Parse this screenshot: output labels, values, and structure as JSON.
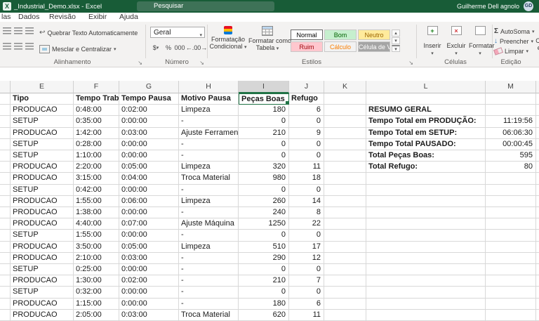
{
  "title_bar": {
    "window_title": "_Industrial_Demo.xlsx - Excel",
    "search_placeholder": "Pesquisar",
    "user_name": "Guilherme Dell agnolo",
    "avatar_initials": "GD"
  },
  "menu": {
    "partial_tab": "las",
    "tabs": [
      "Dados",
      "Revisão",
      "Exibir",
      "Ajuda"
    ]
  },
  "ribbon": {
    "alignment": {
      "wrap_text_label": "Quebrar Texto Automaticamente",
      "merge_center_label": "Mesclar e Centralizar",
      "group_label": "Alinhamento"
    },
    "number": {
      "format_value": "Geral",
      "currency_label": "$",
      "percent_label": "%",
      "comma_label": "000",
      "inc_decimal_label": "←.0",
      "dec_decimal_label": ".0→",
      "group_label": "Número"
    },
    "styles": {
      "conditional_line1": "Formatação",
      "conditional_line2": "Condicional",
      "format_table_line1": "Formatar como",
      "format_table_line2": "Tabela",
      "group_label": "Estilos",
      "gallery": [
        {
          "label": "Normal",
          "bg": "#ffffff",
          "fg": "#000000",
          "selected": true
        },
        {
          "label": "Bom",
          "bg": "#c6efce",
          "fg": "#006100",
          "selected": false
        },
        {
          "label": "Neutro",
          "bg": "#ffeb9c",
          "fg": "#9c6500",
          "selected": false
        },
        {
          "label": "Ruim",
          "bg": "#ffc7ce",
          "fg": "#9c0006",
          "selected": false
        },
        {
          "label": "Cálculo",
          "bg": "#f2f2f2",
          "fg": "#fa7d00",
          "selected": false
        },
        {
          "label": "Célula de Ve...",
          "bg": "#a5a5a5",
          "fg": "#ffffff",
          "selected": false
        }
      ]
    },
    "cells": {
      "buttons": [
        "Inserir",
        "Excluir",
        "Formatar"
      ],
      "group_label": "Células"
    },
    "editing": {
      "autosum_label": "AutoSoma",
      "fill_label": "Preencher",
      "clear_label": "Limpar",
      "sort_line1": "Classificar",
      "sort_line2": "e Filtrar",
      "group_label": "Edição"
    }
  },
  "grid": {
    "column_letters": [
      "E",
      "F",
      "G",
      "H",
      "I",
      "J",
      "K",
      "L",
      "M"
    ],
    "header_row": [
      "Tipo",
      "Tempo Trab.",
      "Tempo Pausa",
      "Motivo Pausa",
      "Peças Boas",
      "Refugo"
    ],
    "selected_cell": "I1",
    "rows": [
      [
        "PRODUCAO",
        "0:48:00",
        "0:02:00",
        "Limpeza",
        "180",
        "6"
      ],
      [
        "SETUP",
        "0:35:00",
        "0:00:00",
        "-",
        "0",
        "0"
      ],
      [
        "PRODUCAO",
        "1:42:00",
        "0:03:00",
        "Ajuste Ferrament",
        "210",
        "9"
      ],
      [
        "SETUP",
        "0:28:00",
        "0:00:00",
        "-",
        "0",
        "0"
      ],
      [
        "SETUP",
        "1:10:00",
        "0:00:00",
        "-",
        "0",
        "0"
      ],
      [
        "PRODUCAO",
        "2:20:00",
        "0:05:00",
        "Limpeza",
        "320",
        "11"
      ],
      [
        "PRODUCAO",
        "3:15:00",
        "0:04:00",
        "Troca Material",
        "980",
        "18"
      ],
      [
        "SETUP",
        "0:42:00",
        "0:00:00",
        "-",
        "0",
        "0"
      ],
      [
        "PRODUCAO",
        "1:55:00",
        "0:06:00",
        "Limpeza",
        "260",
        "14"
      ],
      [
        "PRODUCAO",
        "1:38:00",
        "0:00:00",
        "-",
        "240",
        "8"
      ],
      [
        "PRODUCAO",
        "4:40:00",
        "0:07:00",
        "Ajuste Máquina",
        "1250",
        "22"
      ],
      [
        "SETUP",
        "1:55:00",
        "0:00:00",
        "-",
        "0",
        "0"
      ],
      [
        "PRODUCAO",
        "3:50:00",
        "0:05:00",
        "Limpeza",
        "510",
        "17"
      ],
      [
        "PRODUCAO",
        "2:10:00",
        "0:03:00",
        "-",
        "290",
        "12"
      ],
      [
        "SETUP",
        "0:25:00",
        "0:00:00",
        "-",
        "0",
        "0"
      ],
      [
        "PRODUCAO",
        "1:30:00",
        "0:02:00",
        "-",
        "210",
        "7"
      ],
      [
        "SETUP",
        "0:32:00",
        "0:00:00",
        "-",
        "0",
        "0"
      ],
      [
        "PRODUCAO",
        "1:15:00",
        "0:00:00",
        "-",
        "180",
        "6"
      ],
      [
        "PRODUCAO",
        "2:05:00",
        "0:03:00",
        "Troca Material",
        "620",
        "11"
      ]
    ],
    "summary": {
      "title": "RESUMO GERAL",
      "items": [
        {
          "label": "Tempo Total em PRODUÇÃO:",
          "value": "11:19:56"
        },
        {
          "label": "Tempo Total em SETUP:",
          "value": "06:06:30"
        },
        {
          "label": "Tempo Total PAUSADO:",
          "value": "00:00:45"
        },
        {
          "label": "Total Peças Boas:",
          "value": "595"
        },
        {
          "label": "Total Refugo:",
          "value": "80"
        }
      ]
    }
  },
  "colors": {
    "titlebar_green": "#185C37",
    "selection_green": "#217346"
  }
}
